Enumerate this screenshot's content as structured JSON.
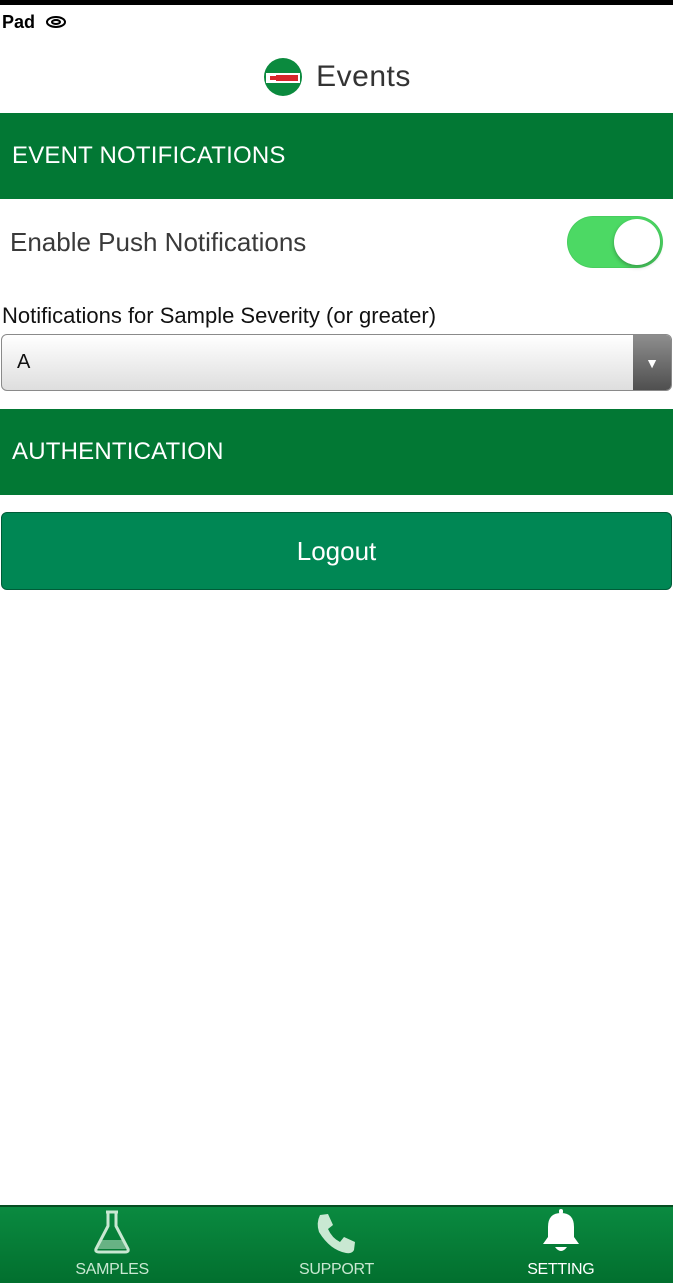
{
  "status_bar": {
    "carrier": "Pad"
  },
  "header": {
    "title": "Events"
  },
  "sections": {
    "event_notifications": "EVENT NOTIFICATIONS",
    "authentication": "AUTHENTICATION"
  },
  "push": {
    "label": "Enable Push Notifications",
    "enabled": true
  },
  "severity": {
    "label": "Notifications for Sample Severity (or greater)",
    "selected": "A"
  },
  "logout": {
    "label": "Logout"
  },
  "nav": {
    "items": [
      {
        "label": "SAMPLES",
        "icon": "flask-icon"
      },
      {
        "label": "SUPPORT",
        "icon": "phone-icon"
      },
      {
        "label": "SETTING",
        "icon": "bell-icon"
      }
    ],
    "active_index": 2
  },
  "colors": {
    "brand_green": "#027834",
    "button_green": "#008754",
    "toggle_on": "#4cd964"
  }
}
